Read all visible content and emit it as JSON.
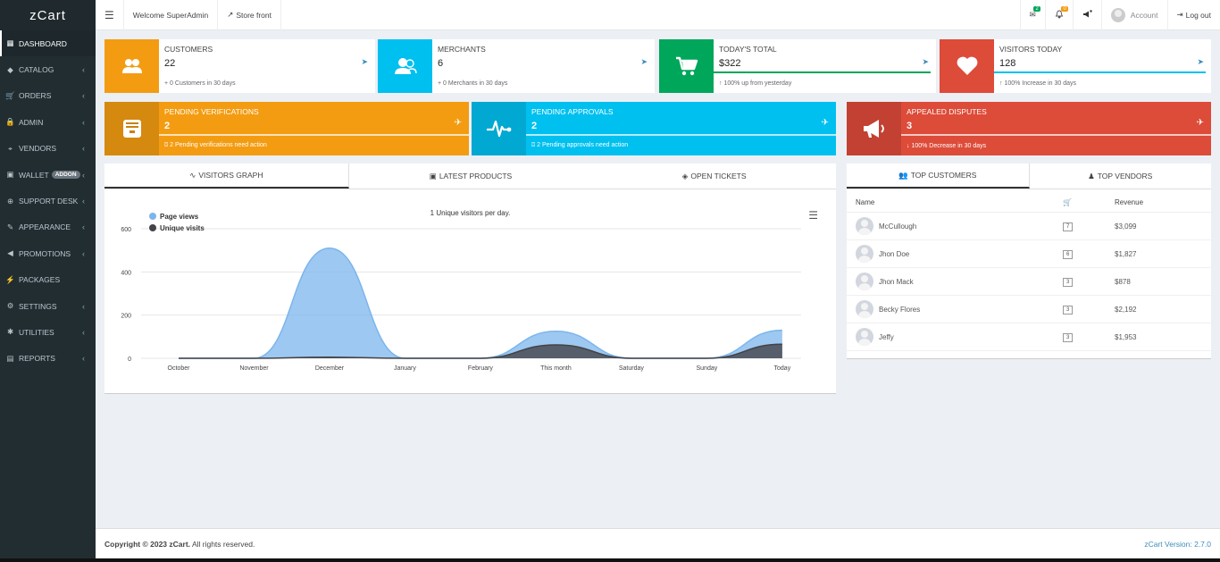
{
  "app": {
    "title": "zCart"
  },
  "sidebar": {
    "items": [
      {
        "label": "DASHBOARD",
        "icon": "dashboard-icon",
        "active": true
      },
      {
        "label": "CATALOG",
        "icon": "tag-icon"
      },
      {
        "label": "ORDERS",
        "icon": "cart-icon"
      },
      {
        "label": "ADMIN",
        "icon": "lock-icon"
      },
      {
        "label": "VENDORS",
        "icon": "map-marker-icon"
      },
      {
        "label": "WALLET",
        "icon": "wallet-icon",
        "badge": "ADDON"
      },
      {
        "label": "SUPPORT DESK",
        "icon": "lifebuoy-icon"
      },
      {
        "label": "APPEARANCE",
        "icon": "paint-brush-icon"
      },
      {
        "label": "PROMOTIONS",
        "icon": "bullhorn-icon"
      },
      {
        "label": "PACKAGES",
        "icon": "plug-icon"
      },
      {
        "label": "SETTINGS",
        "icon": "gears-icon"
      },
      {
        "label": "UTILITIES",
        "icon": "asterisk-icon"
      },
      {
        "label": "REPORTS",
        "icon": "map-icon"
      }
    ]
  },
  "header": {
    "welcome": "Welcome SuperAdmin",
    "storefront": "Store front",
    "messages_count": "2",
    "notifications_count": "0",
    "account": "Account",
    "logout": "Log out"
  },
  "stats": {
    "customers": {
      "label": "CUSTOMERS",
      "value": "22",
      "sub": "0 Customers in 30 days"
    },
    "merchants": {
      "label": "MERCHANTS",
      "value": "6",
      "sub": "0 Merchants in 30 days"
    },
    "todays_total": {
      "label": "TODAY'S TOTAL",
      "value": "$322",
      "sub": "100% up from yesterday"
    },
    "visitors": {
      "label": "VISITORS TODAY",
      "value": "128",
      "sub": "100% Increase in 30 days"
    }
  },
  "alerts": {
    "verifications": {
      "label": "PENDING VERIFICATIONS",
      "value": "2",
      "sub": "2 Pending verifications need action"
    },
    "approvals": {
      "label": "PENDING APPROVALS",
      "value": "2",
      "sub": "2 Pending approvals need action"
    },
    "disputes": {
      "label": "APPEALED DISPUTES",
      "value": "3",
      "sub": "100% Decrease in 30 days"
    }
  },
  "tabs_left": [
    "VISITORS GRAPH",
    "LATEST PRODUCTS",
    "OPEN TICKETS"
  ],
  "tabs_right": [
    "TOP CUSTOMERS",
    "TOP VENDORS"
  ],
  "top_customers": {
    "headers": {
      "name": "Name",
      "revenue": "Revenue"
    },
    "rows": [
      {
        "name": "McCullough",
        "orders": "7",
        "revenue": "$3,099"
      },
      {
        "name": "Jhon Doe",
        "orders": "6",
        "revenue": "$1,827"
      },
      {
        "name": "Jhon Mack",
        "orders": "3",
        "revenue": "$878"
      },
      {
        "name": "Becky Flores",
        "orders": "3",
        "revenue": "$2,192"
      },
      {
        "name": "Jeffy",
        "orders": "3",
        "revenue": "$1,953"
      }
    ]
  },
  "chart_data": {
    "type": "area",
    "title": "1 Unique visitors per day.",
    "categories": [
      "October",
      "November",
      "December",
      "January",
      "February",
      "This month",
      "Saturday",
      "Sunday",
      "Today"
    ],
    "ylim": [
      0,
      600
    ],
    "yticks": [
      0,
      200,
      400,
      600
    ],
    "legend": "top-left",
    "series": [
      {
        "name": "Page views",
        "color": "#7cb5ec",
        "values": [
          0,
          0,
          510,
          0,
          0,
          125,
          0,
          0,
          130
        ]
      },
      {
        "name": "Unique visits",
        "color": "#434348",
        "values": [
          0,
          0,
          5,
          0,
          0,
          62,
          0,
          0,
          65
        ]
      }
    ]
  },
  "footer": {
    "copyright_prefix": "Copyright © 2023",
    "brand": "zCart.",
    "rights": "All rights reserved.",
    "version": "zCart Version: 2.7.0"
  }
}
